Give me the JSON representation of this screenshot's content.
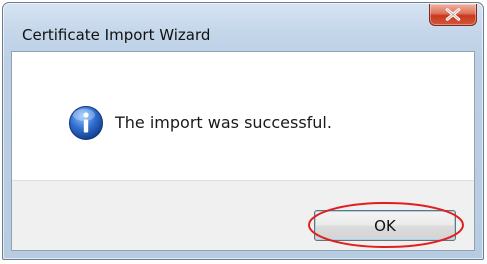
{
  "window": {
    "title": "Certificate Import Wizard"
  },
  "title_bar": {
    "close_icon": "close-icon"
  },
  "message": {
    "icon": "info-icon",
    "text": "The import was successful."
  },
  "buttons": {
    "ok_label": "OK"
  },
  "colors": {
    "highlight": "#e02020",
    "close_button": "#c8381c",
    "info_icon": "#2f6fd0"
  }
}
